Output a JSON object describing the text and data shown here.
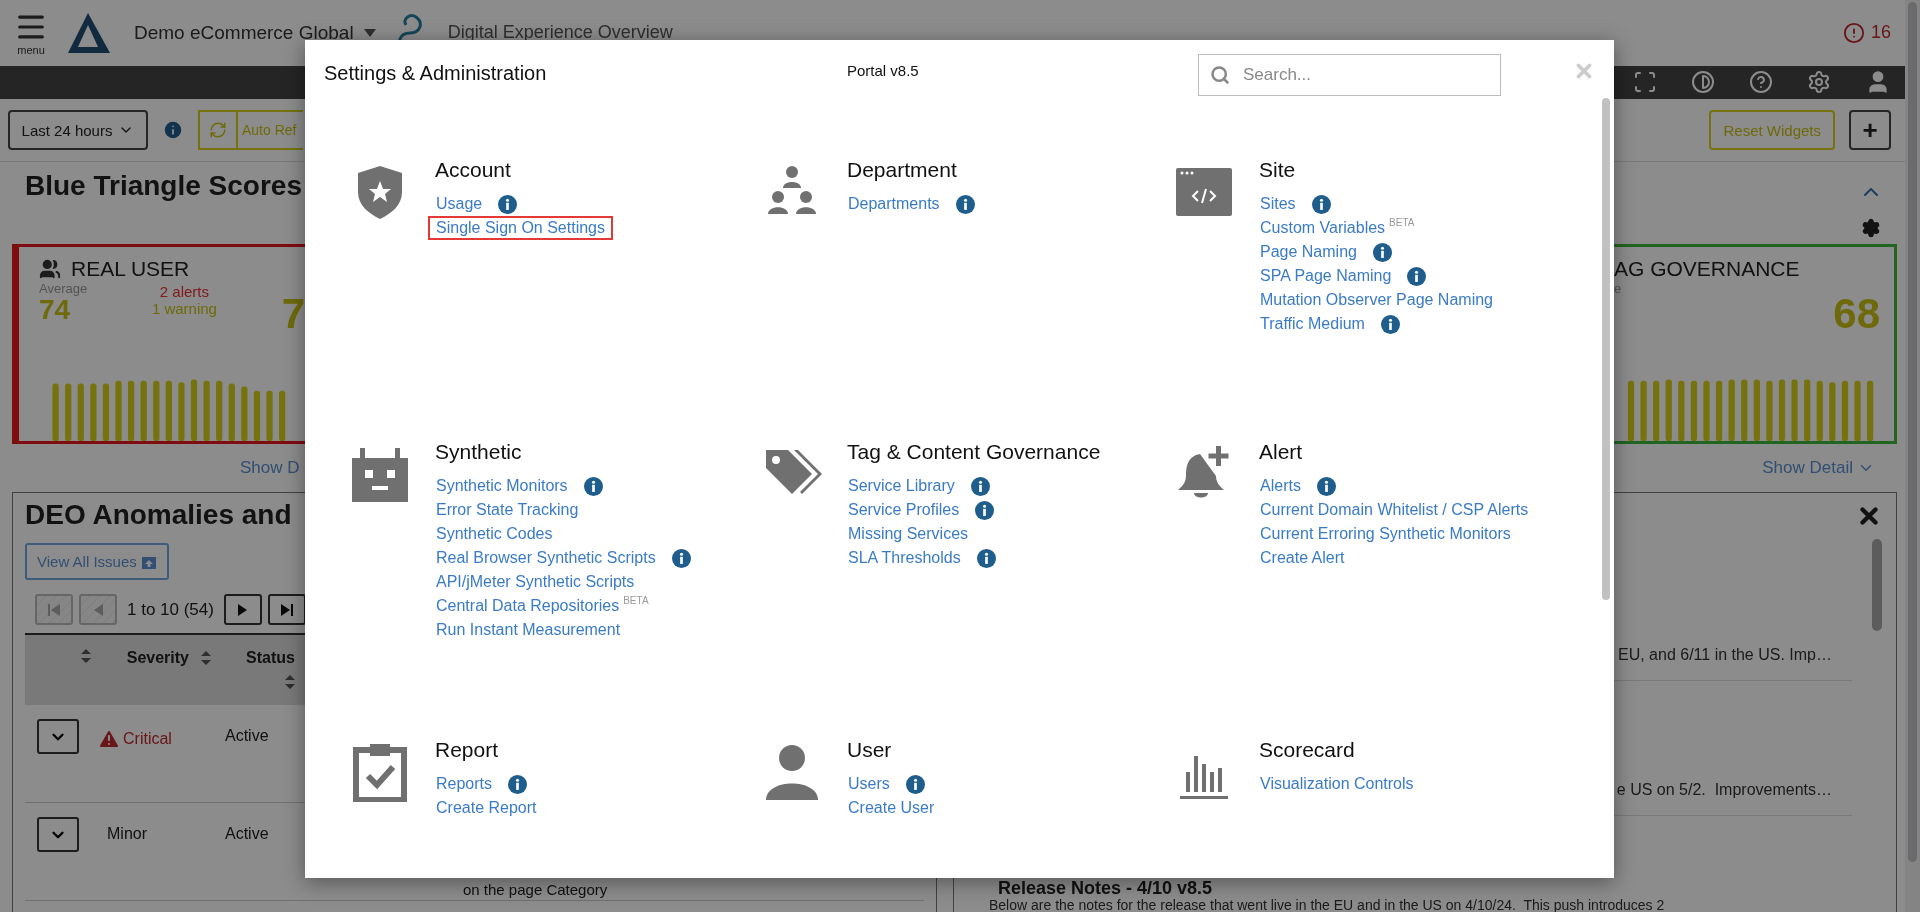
{
  "header": {
    "menu_label": "menu",
    "organization": "Demo eCommerce Global",
    "page_title": "Digital Experience Overview",
    "alert_count": "16"
  },
  "toolbar": {
    "time_range": "Last 24 hours",
    "auto_refresh": "Auto Ref",
    "reset_button": "Reset Widgets",
    "add_button": "+"
  },
  "scores": {
    "title": "Blue Triangle Scores",
    "real_user_card": {
      "title": "REAL USER",
      "average_label": "Average",
      "average": "74",
      "alerts": "2 alerts",
      "warnings": "1 warning",
      "score": "7"
    },
    "tag_card": {
      "title": "AG GOVERNANCE",
      "average_label": "e",
      "score": "68"
    },
    "show_detail_left": "Show D",
    "show_detail_right": "Show Detail"
  },
  "anomalies": {
    "title": "DEO Anomalies and",
    "view_all": "View All Issues",
    "pager": {
      "range": "1 to 10 (54)",
      "buttons": [
        {
          "kind": "first",
          "disabled": true
        },
        {
          "kind": "previous",
          "disabled": true
        },
        {
          "kind": "next",
          "disabled": false
        },
        {
          "kind": "last",
          "disabled": false
        }
      ]
    },
    "columns": [
      "Severity",
      "Status"
    ],
    "rows": [
      {
        "kind": "critical",
        "severity": "Critical",
        "status": "Active"
      },
      {
        "kind": "minor",
        "severity": "Minor",
        "status": "Active",
        "description": "on the page Category"
      }
    ]
  },
  "release_notes": {
    "snippets": [
      "EU, and 6/11 in the US. Imp…",
      "e US on 5/2.  Improvements…"
    ],
    "heading": "Release Notes - 4/10 v8.5",
    "intro": "Below are the notes for the release that went live in the EU and in the US on 4/10/24.  This push introduces 2"
  },
  "modal": {
    "title": "Settings & Administration",
    "version": "Portal v8.5",
    "search": {
      "placeholder": "Search..."
    },
    "sections": [
      {
        "title": "Account",
        "links": [
          {
            "label": "Usage",
            "info": true,
            "highlighted": false
          },
          {
            "label": "Single Sign On Settings",
            "info": false,
            "highlighted": true
          }
        ]
      },
      {
        "title": "Department",
        "links": [
          {
            "label": "Departments",
            "info": true,
            "highlighted": false
          }
        ]
      },
      {
        "title": "Site",
        "links": [
          {
            "label": "Sites",
            "info": true,
            "highlighted": false
          },
          {
            "label": "Custom Variables",
            "badge": "BETA",
            "info": false,
            "highlighted": false
          },
          {
            "label": "Page Naming",
            "info": true,
            "highlighted": false
          },
          {
            "label": "SPA Page Naming",
            "info": true,
            "highlighted": false
          },
          {
            "label": "Mutation Observer Page Naming",
            "info": false,
            "highlighted": false
          },
          {
            "label": "Traffic Medium",
            "info": true,
            "highlighted": false
          }
        ]
      },
      {
        "title": "Synthetic",
        "links": [
          {
            "label": "Synthetic Monitors",
            "info": true,
            "highlighted": false
          },
          {
            "label": "Error State Tracking",
            "info": false,
            "highlighted": false
          },
          {
            "label": "Synthetic Codes",
            "info": false,
            "highlighted": false
          },
          {
            "label": "Real Browser Synthetic Scripts",
            "info": true,
            "highlighted": false
          },
          {
            "label": "API/jMeter Synthetic Scripts",
            "info": false,
            "highlighted": false
          },
          {
            "label": "Central Data Repositories",
            "badge": "BETA",
            "info": false,
            "highlighted": false
          },
          {
            "label": "Run Instant Measurement",
            "info": false,
            "highlighted": false
          }
        ]
      },
      {
        "title": "Tag & Content Governance",
        "links": [
          {
            "label": "Service Library",
            "info": true,
            "highlighted": false
          },
          {
            "label": "Service Profiles",
            "info": true,
            "highlighted": false
          },
          {
            "label": "Missing Services",
            "info": false,
            "highlighted": false
          },
          {
            "label": "SLA Thresholds",
            "info": true,
            "highlighted": false
          }
        ]
      },
      {
        "title": "Alert",
        "links": [
          {
            "label": "Alerts",
            "info": true,
            "highlighted": false
          },
          {
            "label": "Current Domain Whitelist / CSP Alerts",
            "info": false,
            "highlighted": false
          },
          {
            "label": "Current Erroring Synthetic Monitors",
            "info": false,
            "highlighted": false
          },
          {
            "label": "Create Alert",
            "info": false,
            "highlighted": false
          }
        ]
      },
      {
        "title": "Report",
        "links": [
          {
            "label": "Reports",
            "info": true,
            "highlighted": false
          },
          {
            "label": "Create Report",
            "info": false,
            "highlighted": false
          }
        ]
      },
      {
        "title": "User",
        "links": [
          {
            "label": "Users",
            "info": true,
            "highlighted": false
          },
          {
            "label": "Create User",
            "info": false,
            "highlighted": false
          }
        ]
      },
      {
        "title": "Scorecard",
        "links": [
          {
            "label": "Visualization Controls",
            "info": false,
            "highlighted": false
          }
        ]
      }
    ]
  }
}
